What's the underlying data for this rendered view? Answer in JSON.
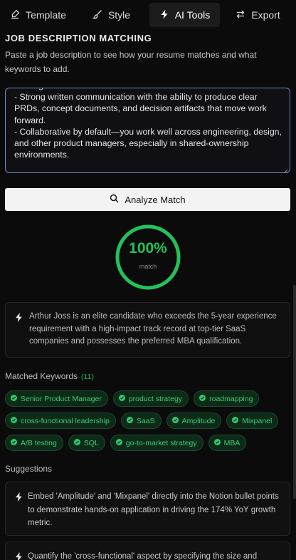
{
  "tabs": [
    {
      "label": "Template",
      "icon": "brush-icon",
      "active": false
    },
    {
      "label": "Style",
      "icon": "paint-brush-icon",
      "active": false
    },
    {
      "label": "AI Tools",
      "icon": "bolt-icon",
      "active": true
    },
    {
      "label": "Export",
      "icon": "export-icon",
      "active": false
    }
  ],
  "section": {
    "title": "JOB DESCRIPTION MATCHING",
    "description": "Paste a job description to see how your resume matches and what keywords to add."
  },
  "job_description": {
    "value": "framing.\n- Strong written communication with the ability to produce clear PRDs, concept documents, and decision artifacts that move work forward.\n- Collaborative by default—you work well across engineering, design, and other product managers, especially in shared-ownership environments."
  },
  "analyze_button": {
    "label": "Analyze Match",
    "icon": "search-icon"
  },
  "match": {
    "score_text": "100%",
    "score": 1.0,
    "label": "match",
    "color": "#22c25a"
  },
  "summary": {
    "icon": "bolt-icon",
    "text": "Arthur Joss is an elite candidate who exceeds the 5-year experience requirement with a high-impact track record at top-tier SaaS companies and possesses the preferred MBA qualification."
  },
  "keywords": {
    "title": "Matched Keywords",
    "count": "(11)",
    "items": [
      "Senior Product Manager",
      "product strategy",
      "roadmapping",
      "cross-functional leadership",
      "SaaS",
      "Amplitude",
      "Mixpanel",
      "A/B testing",
      "SQL",
      "go-to-market strategy",
      "MBA"
    ]
  },
  "suggestions": {
    "title": "Suggestions",
    "items": [
      "Embed 'Amplitude' and 'Mixpanel' directly into the Notion bullet points to demonstrate hands-on application in driving the 174% YoY growth metric.",
      "Quantify the 'cross-functional' aspect by specifying the size and"
    ]
  },
  "colors": {
    "accent": "#22c25a",
    "focus_border": "#6f89c9",
    "chip_bg": "#0e2a19"
  }
}
